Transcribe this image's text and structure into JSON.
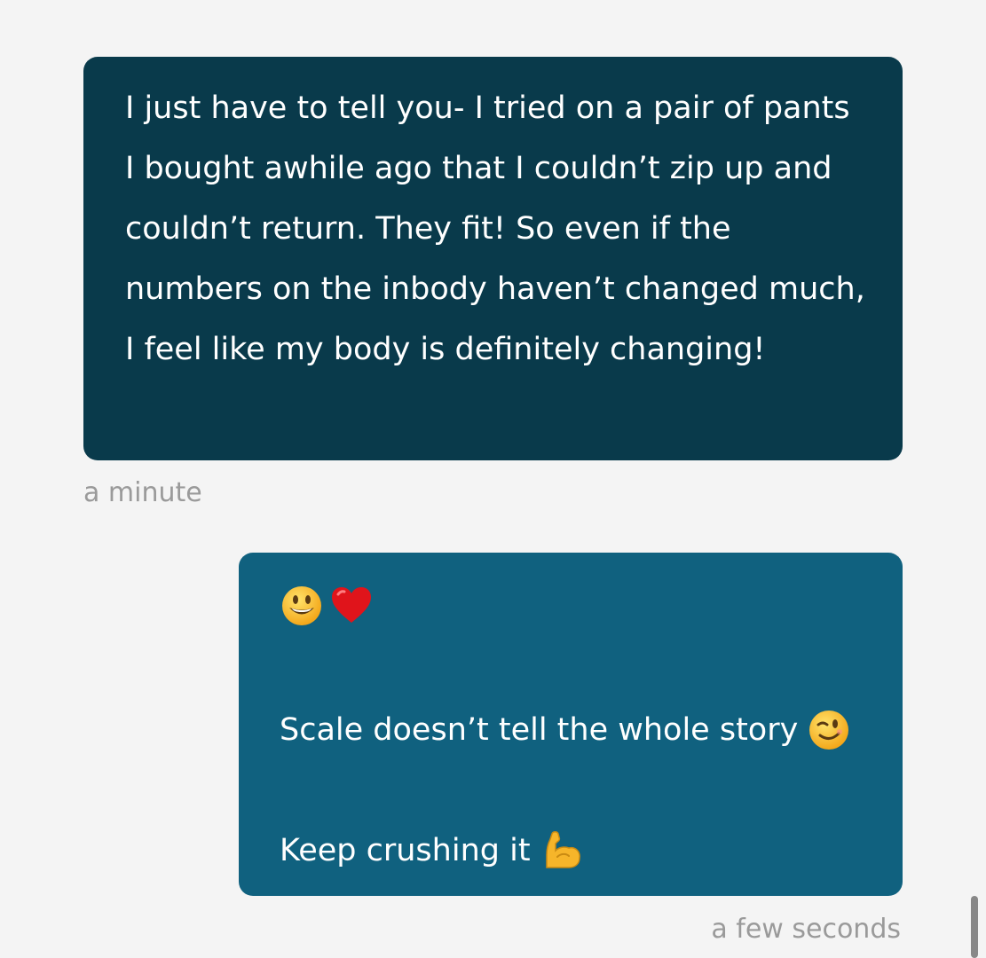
{
  "messages": {
    "incoming": {
      "text": "I just have to tell you- I tried on a pair of pants I bought awhile ago that I couldn’t zip up and couldn’t return. They fit! So even if the numbers on the inbody haven’t changed much, I feel like my body is definitely changing!",
      "timestamp": "a minute"
    },
    "outgoing": {
      "emoji_line": [
        "smiley-emoji",
        "red-heart-emoji"
      ],
      "line1": "Scale doesn’t tell the whole story",
      "line1_emoji": "wink-emoji",
      "line2": "Keep crushing it",
      "line2_emoji": "flexed-bicep-emoji",
      "timestamp": "a few seconds"
    }
  },
  "colors": {
    "background": "#f4f4f4",
    "incoming_bubble": "#093a4b",
    "outgoing_bubble": "#10617f",
    "timestamp_text": "#9a9a9a"
  }
}
